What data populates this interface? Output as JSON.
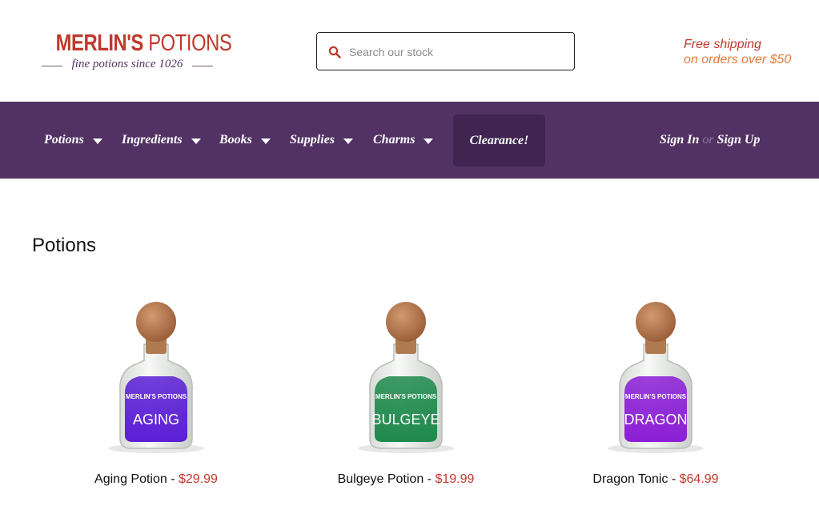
{
  "header": {
    "logo": {
      "title_bold": "MERLIN'S",
      "title_thin": "POTIONS",
      "tagline": "fine potions since 1026"
    },
    "search": {
      "placeholder": "Search our stock",
      "value": ""
    },
    "shipping": {
      "line1": "Free shipping",
      "line2": "on orders over $50"
    }
  },
  "nav": {
    "items": [
      {
        "label": "Potions",
        "icon": "caret-down-icon"
      },
      {
        "label": "Ingredients",
        "icon": "caret-down-icon"
      },
      {
        "label": "Books",
        "icon": "caret-down-icon"
      },
      {
        "label": "Supplies",
        "icon": "caret-down-icon"
      },
      {
        "label": "Charms",
        "icon": "caret-down-icon"
      }
    ],
    "clearance": "Clearance!",
    "sign_in": "Sign In",
    "or": "or",
    "sign_up": "Sign Up"
  },
  "main": {
    "title": "Potions",
    "products": [
      {
        "name": "Aging Potion",
        "separator": " - ",
        "price": "$29.99",
        "label": "AGING",
        "brand": "MERLIN'S POTIONS",
        "liquid_color": "#5b1fd6"
      },
      {
        "name": "Bulgeye Potion",
        "separator": " - ",
        "price": "$19.99",
        "label": "BULGEYE",
        "brand": "MERLIN'S POTIONS",
        "liquid_color": "#1f8a4c"
      },
      {
        "name": "Dragon Tonic",
        "separator": " - ",
        "price": "$64.99",
        "label": "DRAGON",
        "brand": "MERLIN'S POTIONS",
        "liquid_color": "#8b1fd6"
      }
    ]
  },
  "colors": {
    "brand_red": "#c0392b",
    "nav_purple": "#523264",
    "clearance_bg": "#3f2550",
    "shipping_orange": "#e07b3c"
  },
  "icons": {
    "search": "search-icon"
  }
}
